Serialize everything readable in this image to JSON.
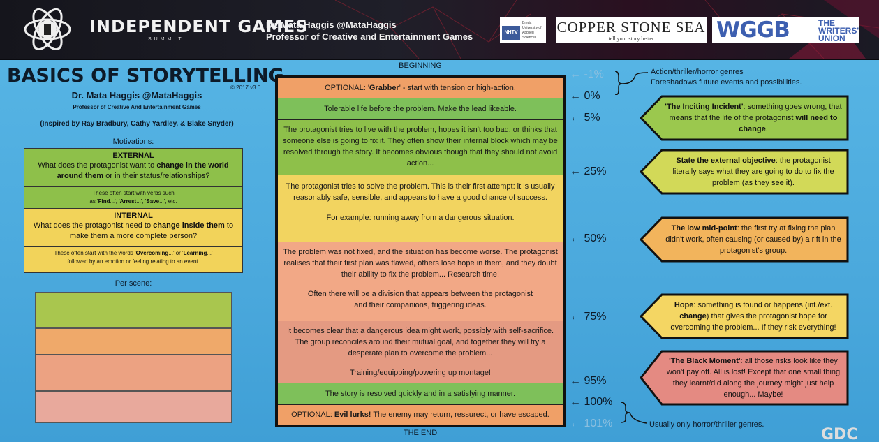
{
  "header": {
    "logo_title": "INDEPENDENT GAMES",
    "logo_subtitle": "SUMMIT",
    "speaker": "Dr. Mata Haggis @MataHaggis",
    "speaker_role": "Professor of Creative and Entertainment Games",
    "nhtv": {
      "badge": "NHTV",
      "text": "Breda University of Applied Sciences"
    },
    "copper": {
      "title": "COPPER STONE SEA",
      "tagline": "tell your story better"
    },
    "wggb": {
      "mark": "WGGB",
      "line1": "THE",
      "line2": "WRITERS'",
      "line3": "UNION"
    }
  },
  "poster": {
    "title": "BASICS OF STORYTELLING",
    "version": "© 2017 v3.0",
    "author": "Dr. Mata Haggis @MataHaggis",
    "author_role": "Professor of Creative And Entertainment Games",
    "inspired": "(Inspired by Ray Bradbury, Cathy Yardley, & Blake Snyder)",
    "motivations_label": "Motivations:",
    "external": {
      "heading": "EXTERNAL",
      "q1": "What does the protagonist want to ",
      "q1b": "change in the world around them",
      "q1c": " or in their status/relationships?",
      "note1": "These often start with verbs such",
      "note2a": "as '",
      "note2b": "Find",
      "note2c": "...', '",
      "note2d": "Arrest",
      "note2e": "...', '",
      "note2f": "Save",
      "note2g": "...', etc."
    },
    "internal": {
      "heading": "INTERNAL",
      "q1": "What does the protagonist need to ",
      "q1b": "change inside them",
      "q1c": " to make them a more complete person?",
      "note1a": "These often start with the words '",
      "note1b": "Overcoming",
      "note1c": "...' or '",
      "note1d": "Learning",
      "note1e": "...'",
      "note2": "followed by an emotion or feeling relating to an event."
    },
    "per_scene_label": "Per scene:",
    "scene_colors": [
      "#a9c64e",
      "#efa96a",
      "#eca282",
      "#e8a99c"
    ],
    "beginning": "BEGINNING",
    "the_end": "THE END",
    "rows": {
      "grabber_a": "OPTIONAL: '",
      "grabber_b": "Grabber",
      "grabber_c": "' - start with tension or high-action.",
      "tolerable": "Tolerable life before the problem. Make the lead likeable.",
      "lives_with": "The protagonist tries to live with the problem, hopes it isn't too bad, or thinks that someone else is going to fix it. They often show their internal block which may be resolved through the story. It becomes obvious though that they should not avoid action...",
      "tries_solve": "The protagonist tries to solve the problem. This is their first attempt: it is usually reasonably safe, sensible, and appears to have a good chance of success.",
      "example": "For example: running away from a dangerous situation.",
      "not_fixed": "The problem was not fixed, and the situation has become worse. The protagonist realises that their first plan was flawed, others lose hope in them, and they doubt their ability to fix the problem... Research time!",
      "division": "Often there will be a division that appears between the protagonist and their companions, triggering ideas.",
      "dangerous_idea": "It becomes clear that a dangerous idea might work, possibly with self-sacrifice. The group reconciles around their mutual goal, and together they will try a desperate plan to overcome the problem...",
      "montage": "Training/equipping/powering up montage!",
      "resolved": "The story is resolved quickly and in a satisfying manner.",
      "evil_a": "OPTIONAL: ",
      "evil_b": "Evil lurks!",
      "evil_c": " The enemy may return, ressurect, or have escaped."
    },
    "percents": {
      "m1": "-1%",
      "p0": "0%",
      "p5": "5%",
      "p25": "25%",
      "p50": "50%",
      "p75": "75%",
      "p95": "95%",
      "p100": "100%",
      "p101": "101%"
    },
    "genres_top_1": "Action/thriller/horror genres",
    "genres_top_2": "Foreshadows future events and possibilities.",
    "genres_bottom": "Usually only horror/thriller genres.",
    "callouts": {
      "inciting_a": "'The Inciting Incident'",
      "inciting_b": ": something goes wrong, that means that the life of the protagonist ",
      "inciting_c": "will need to change",
      "inciting_d": ".",
      "objective_a": "State the external objective",
      "objective_b": ": the protagonist literally says what they are going to do to fix the problem (as they see it).",
      "midpoint_a": "The low mid-point",
      "midpoint_b": ": the first try at fixing the plan didn't work, often causing (or caused by) a rift in the protagonist's group.",
      "hope_a": "Hope",
      "hope_b": ": something is found or happens (int./ext. ",
      "hope_c": "change",
      "hope_d": ") that gives the protagonist hope for overcoming the problem... If they risk everything!",
      "black_a": "'The Black Moment'",
      "black_b": ": all those risks look like they won't pay off. All is lost! Except that one small thing they learnt/did along the journey might just help enough... Maybe!"
    },
    "callout_colors": {
      "green": "#9bc84e",
      "lime": "#d2d958",
      "orange": "#f2b45c",
      "yellow": "#f4d663",
      "red": "#e48a82"
    },
    "watermark": "GDC"
  }
}
